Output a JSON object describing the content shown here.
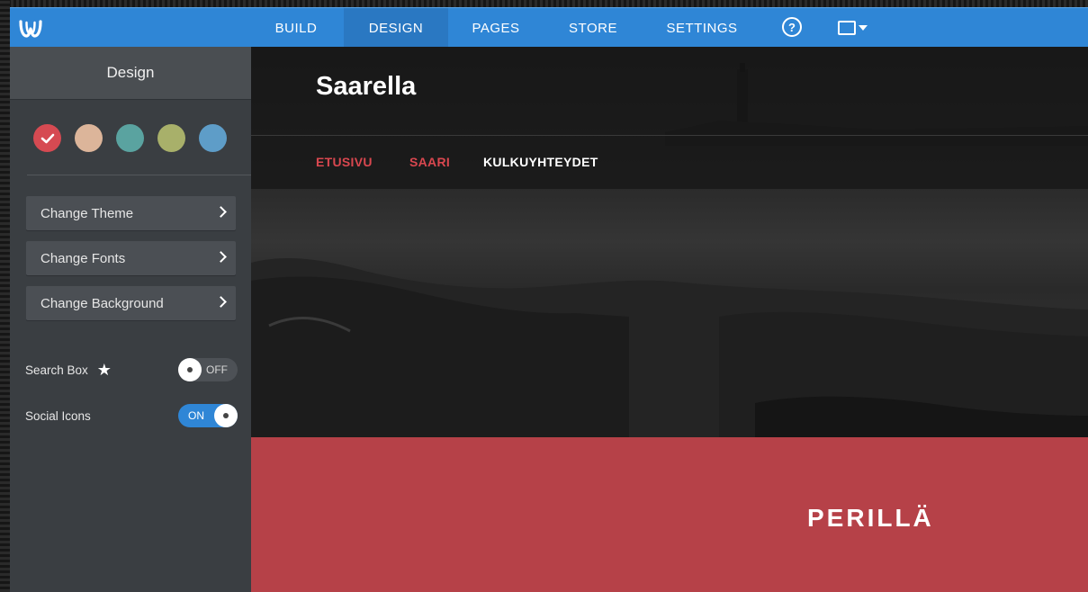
{
  "topbar": {
    "logo": "weebly-w-icon",
    "tabs": [
      {
        "label": "BUILD"
      },
      {
        "label": "DESIGN"
      },
      {
        "label": "PAGES"
      },
      {
        "label": "STORE"
      },
      {
        "label": "SETTINGS"
      }
    ],
    "help_glyph": "?",
    "colors": {
      "bar": "#2f86d6",
      "active_tab": "#2a78c2"
    }
  },
  "sidebar": {
    "title": "Design",
    "swatches": [
      {
        "color": "#d64a52",
        "selected": true
      },
      {
        "color": "#dcb59a",
        "selected": false
      },
      {
        "color": "#5aa3a0",
        "selected": false
      },
      {
        "color": "#a8b06a",
        "selected": false
      },
      {
        "color": "#5e9dc8",
        "selected": false
      }
    ],
    "menu": [
      {
        "label": "Change Theme"
      },
      {
        "label": "Change Fonts"
      },
      {
        "label": "Change Background"
      }
    ],
    "toggles": [
      {
        "label": "Search Box",
        "state": "OFF",
        "icon": "star-icon"
      },
      {
        "label": "Social Icons",
        "state": "ON"
      }
    ]
  },
  "preview": {
    "site_title": "Saarella",
    "nav": [
      {
        "label": "ETUSIVU",
        "color": "#d9474f"
      },
      {
        "label": "SAARI",
        "color": "#d9474f"
      },
      {
        "label": "KULKUYHTEYDET",
        "color": "#ffffff"
      }
    ],
    "band_title": "PERILLÄ",
    "band_color": "#b64148"
  }
}
